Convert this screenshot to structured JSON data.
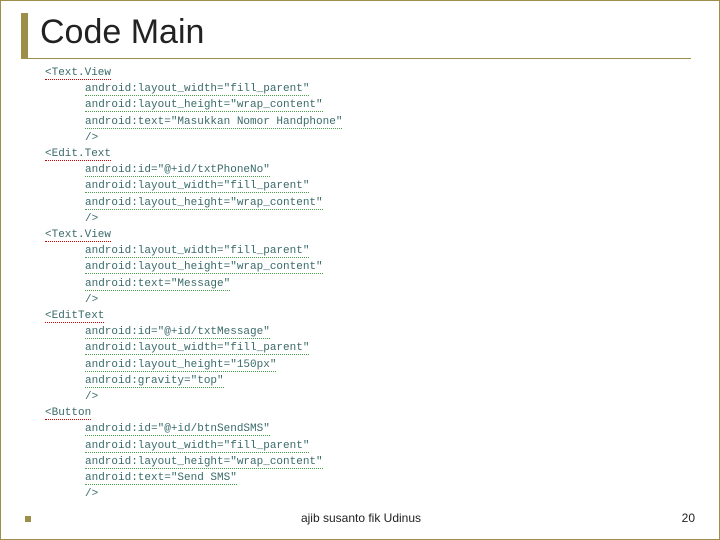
{
  "title": "Code Main",
  "footer": "ajib susanto fik Udinus",
  "page_number": "20",
  "code": {
    "l01": "<Text.View",
    "l02": "android:layout_width=\"fill_parent\"",
    "l03": "android:layout_height=\"wrap_content\"",
    "l04": "android:text=\"Masukkan Nomor Handphone\"",
    "l05": "/>",
    "l06": "<Edit.Text",
    "l07": "android:id=\"@+id/txtPhoneNo\"",
    "l08": "android:layout_width=\"fill_parent\"",
    "l09": "android:layout_height=\"wrap_content\"",
    "l10": "/>",
    "l11": "<Text.View",
    "l12": "android:layout_width=\"fill_parent\"",
    "l13": "android:layout_height=\"wrap_content\"",
    "l14": "android:text=\"Message\"",
    "l15": "/>",
    "l16": "<EditText",
    "l17": "android:id=\"@+id/txtMessage\"",
    "l18": "android:layout_width=\"fill_parent\"",
    "l19": "android:layout_height=\"150px\"",
    "l20": "android:gravity=\"top\"",
    "l21": "/>",
    "l22": "<Button",
    "l23": "android:id=\"@+id/btnSendSMS\"",
    "l24": "android:layout_width=\"fill_parent\"",
    "l25": "android:layout_height=\"wrap_content\"",
    "l26": "android:text=\"Send SMS\"",
    "l27": "/>"
  }
}
